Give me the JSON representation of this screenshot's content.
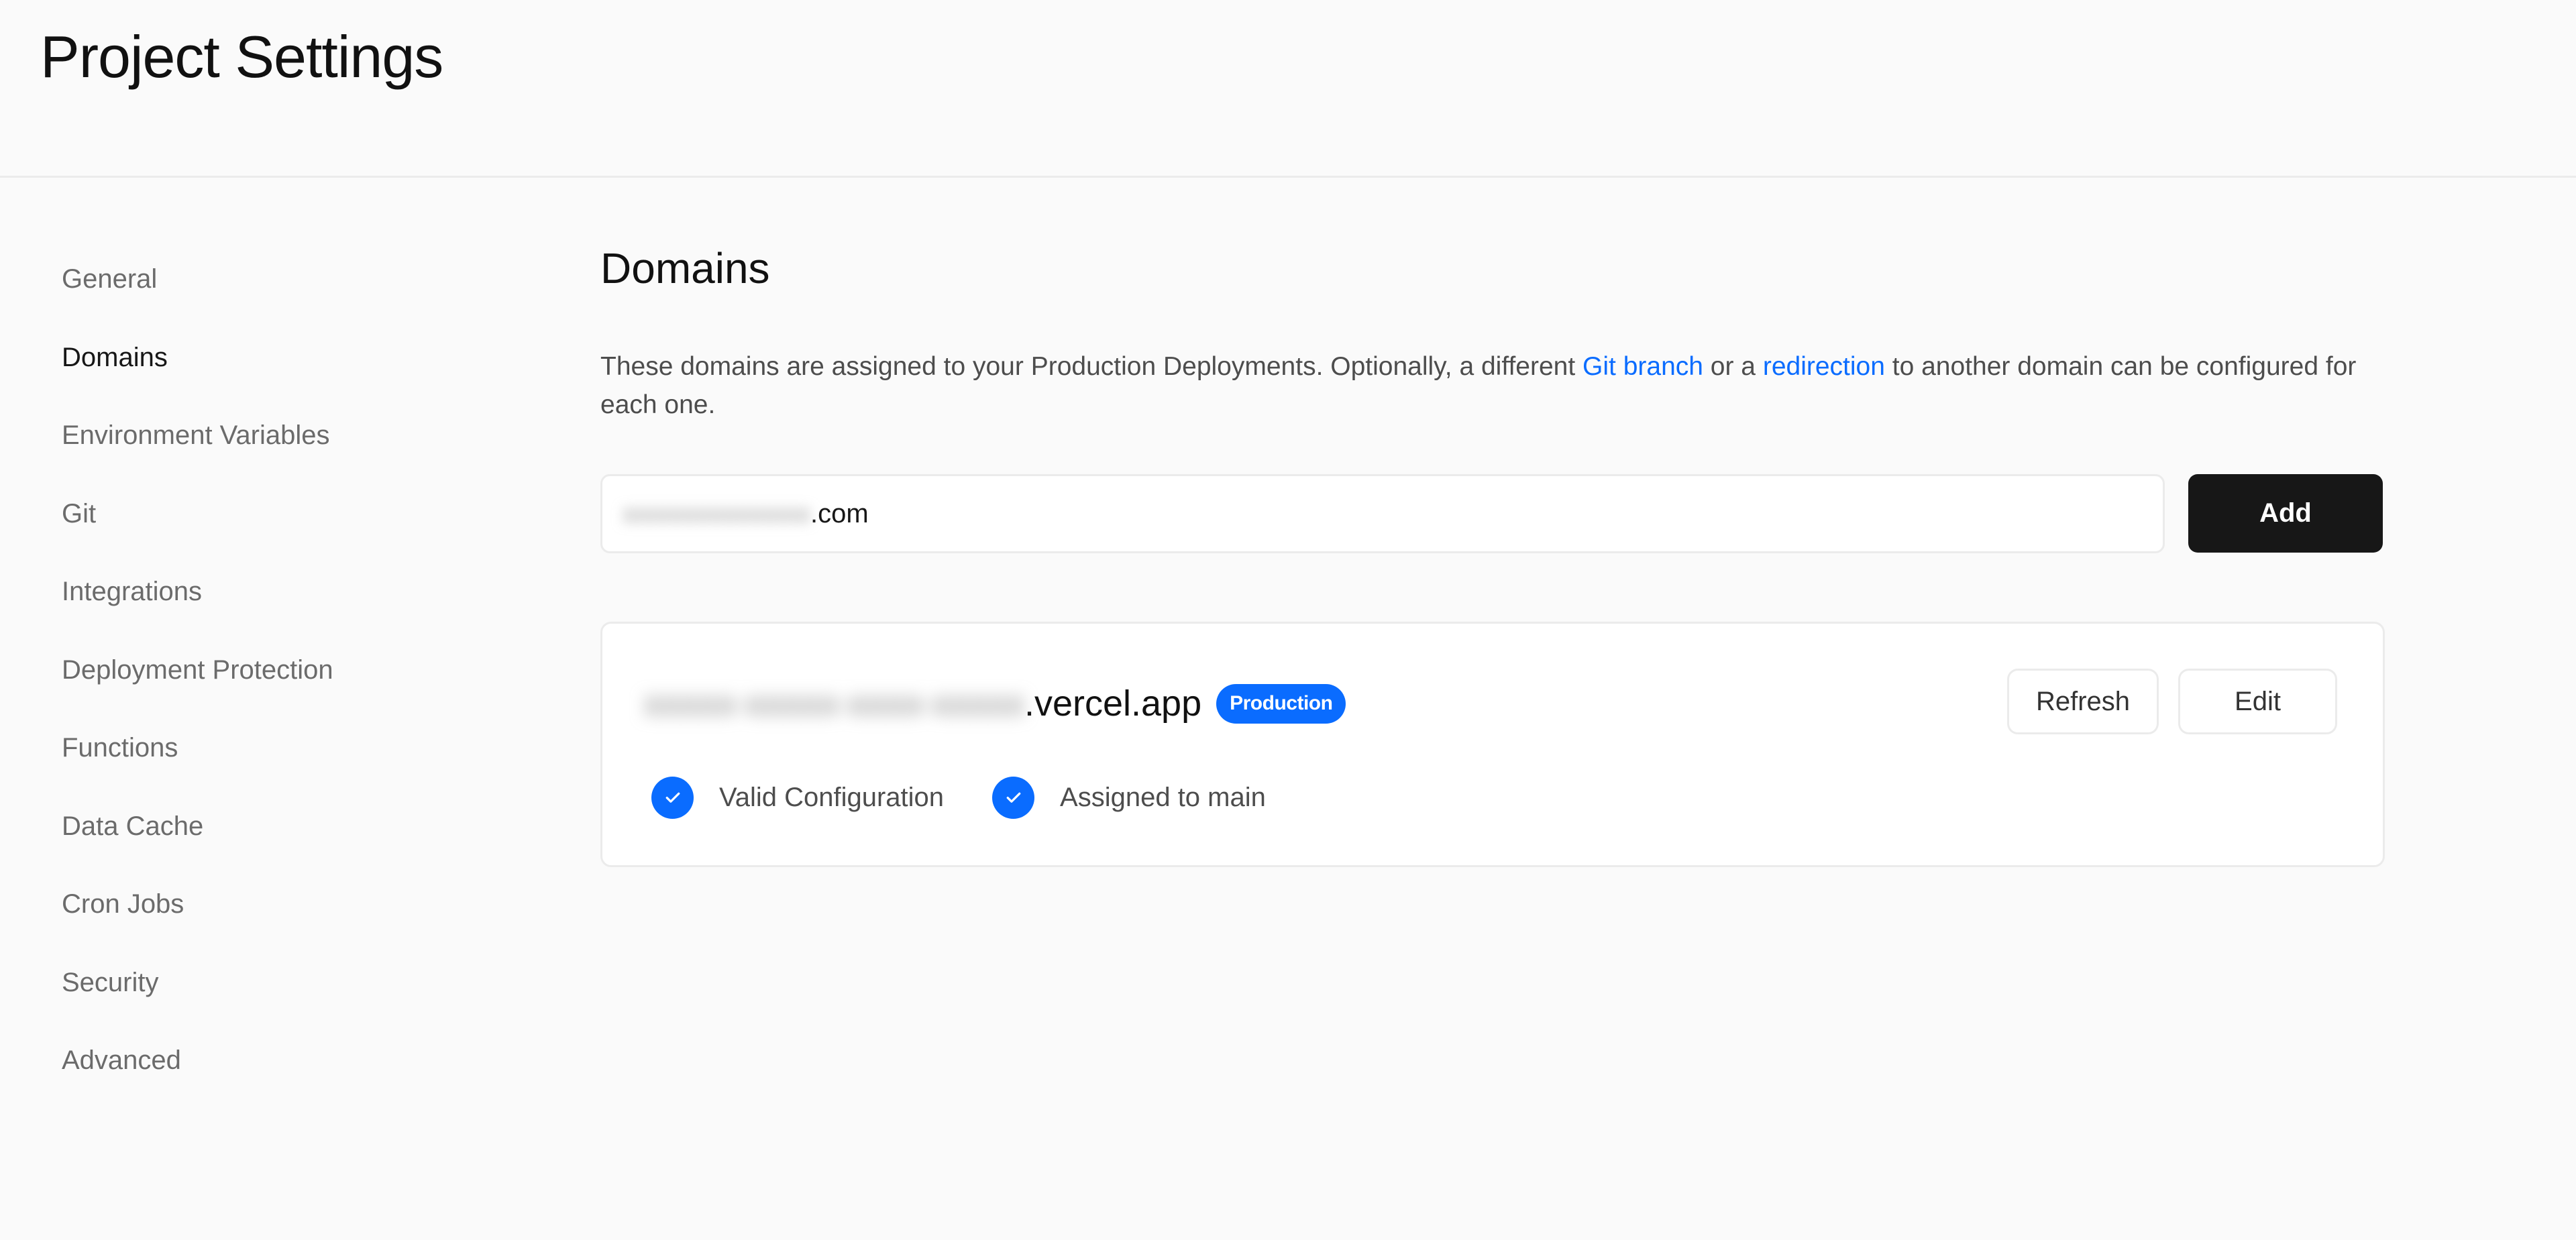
{
  "header": {
    "title": "Project Settings"
  },
  "sidebar": {
    "active": "Domains",
    "items": [
      {
        "label": "General"
      },
      {
        "label": "Domains"
      },
      {
        "label": "Environment Variables"
      },
      {
        "label": "Git"
      },
      {
        "label": "Integrations"
      },
      {
        "label": "Deployment Protection"
      },
      {
        "label": "Functions"
      },
      {
        "label": "Data Cache"
      },
      {
        "label": "Cron Jobs"
      },
      {
        "label": "Security"
      },
      {
        "label": "Advanced"
      }
    ]
  },
  "main": {
    "title": "Domains",
    "description": {
      "part1": "These domains are assigned to your Production Deployments. Optionally, a different ",
      "link1": "Git branch",
      "part2": " or a ",
      "link2": "redirection",
      "part3": " to another domain can be configured for each one."
    },
    "input": {
      "value_redacted": "xxxxxxxxxxxxxx",
      "value_suffix": ".com"
    },
    "add_label": "Add",
    "domains": [
      {
        "name_redacted": "xxxxx-xxxxx-xxxx-xxxxx",
        "name_suffix": ".vercel.app",
        "badge": "Production",
        "refresh_label": "Refresh",
        "edit_label": "Edit",
        "statuses": [
          {
            "icon": "check-circle-icon",
            "label": "Valid Configuration"
          },
          {
            "icon": "check-circle-icon",
            "label": "Assigned to main"
          }
        ]
      }
    ]
  },
  "colors": {
    "accent": "#0a6cff",
    "background": "#fafafa",
    "primary_button": "#171717",
    "border": "#ebebeb"
  }
}
